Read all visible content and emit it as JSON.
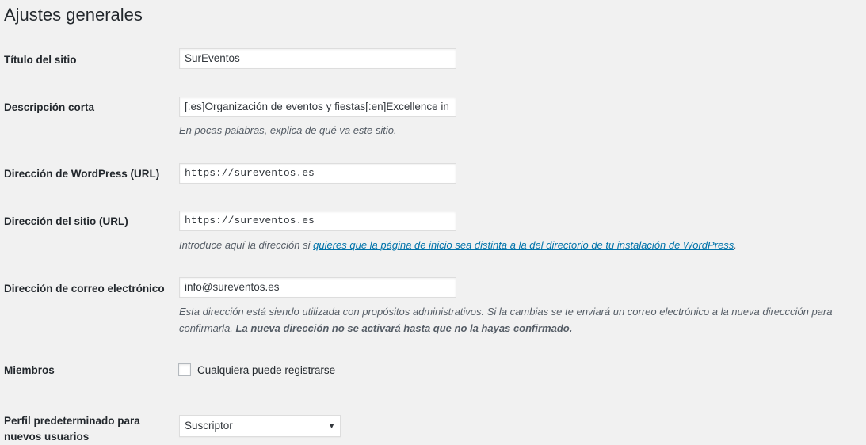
{
  "page": {
    "title": "Ajustes generales"
  },
  "fields": {
    "site_title": {
      "label": "Título del sitio",
      "value": "SurEventos"
    },
    "tagline": {
      "label": "Descripción corta",
      "value": "[:es]Organización de eventos y fiestas[:en]Excellence in",
      "description": "En pocas palabras, explica de qué va este sitio."
    },
    "wp_url": {
      "label": "Dirección de WordPress (URL)",
      "value": "https://sureventos.es"
    },
    "site_url": {
      "label": "Dirección del sitio (URL)",
      "value": "https://sureventos.es",
      "description_prefix": "Introduce aquí la dirección si ",
      "description_link": "quieres que la página de inicio sea distinta a la del directorio de tu instalación de WordPress",
      "description_suffix": "."
    },
    "admin_email": {
      "label": "Dirección de correo electrónico",
      "value": "info@sureventos.es",
      "description_line1": "Esta dirección está siendo utilizada con propósitos administrativos. Si la cambias se te enviará un correo electrónico a la nueva direccción para",
      "description_line2_prefix": "confirmarla. ",
      "description_line2_bold": "La nueva dirección no se activará hasta que no la hayas confirmado."
    },
    "membership": {
      "label": "Miembros",
      "checkbox_label": "Cualquiera puede registrarse",
      "checked": false
    },
    "default_role": {
      "label_line1": "Perfil predeterminado para",
      "label_line2": "nuevos usuarios",
      "selected": "Suscriptor"
    }
  },
  "icons": {
    "select_arrow": "chevron-down-icon"
  }
}
